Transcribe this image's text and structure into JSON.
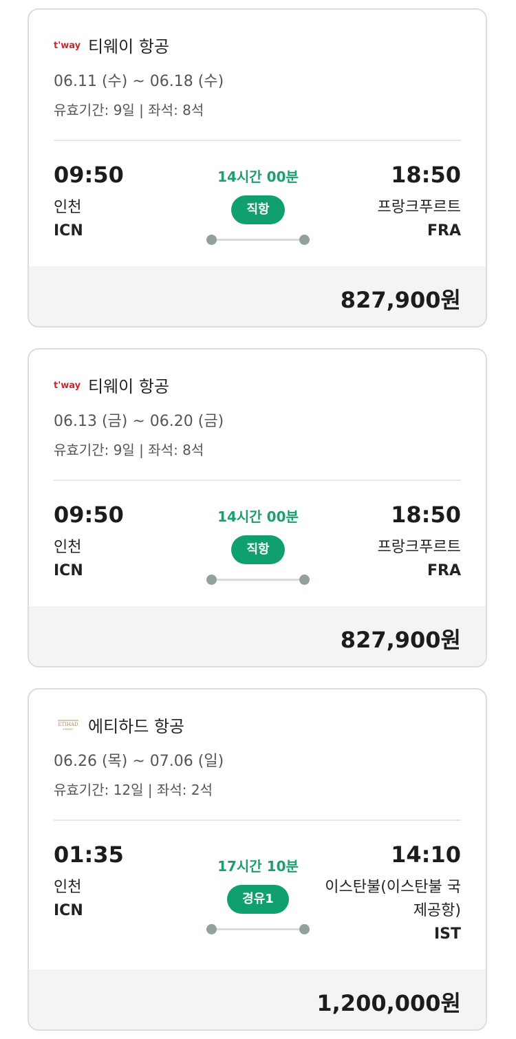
{
  "cards": [
    {
      "airline": "티웨이 항공",
      "logo": "tway-logo",
      "dates": "06.11 (수) ~ 06.18 (수)",
      "validity": "유효기간: 9일 | 좌석: 8석",
      "dep_time": "09:50",
      "dep_city": "인천",
      "dep_code": "ICN",
      "duration": "14시간 00분",
      "stop": "직항",
      "arr_time": "18:50",
      "arr_city": "프랑크푸르트",
      "arr_code": "FRA",
      "price": "827,900원"
    },
    {
      "airline": "티웨이 항공",
      "logo": "tway-logo",
      "dates": "06.13 (금) ~ 06.20 (금)",
      "validity": "유효기간: 9일 | 좌석: 8석",
      "dep_time": "09:50",
      "dep_city": "인천",
      "dep_code": "ICN",
      "duration": "14시간 00분",
      "stop": "직항",
      "arr_time": "18:50",
      "arr_city": "프랑크푸르트",
      "arr_code": "FRA",
      "price": "827,900원"
    },
    {
      "airline": "에티하드 항공",
      "logo": "etihad-logo",
      "dates": "06.26 (목) ~ 07.06 (일)",
      "validity": "유효기간: 12일 | 좌석: 2석",
      "dep_time": "01:35",
      "dep_city": "인천",
      "dep_code": "ICN",
      "duration": "17시간 10분",
      "stop": "경유1",
      "arr_time": "14:10",
      "arr_city_line1": "이스탄불(이스탄불 국",
      "arr_city_line2": "제공항)",
      "arr_code": "IST",
      "price": "1,200,000원"
    }
  ],
  "logos": {
    "tway_text": "t'way",
    "etihad_text": "ETIHAD",
    "etihad_sub": "AIRWAYS"
  },
  "colors": {
    "accent_green": "#10a06e",
    "route_dot": "#92a199",
    "price_bg": "#f4f4f4"
  }
}
